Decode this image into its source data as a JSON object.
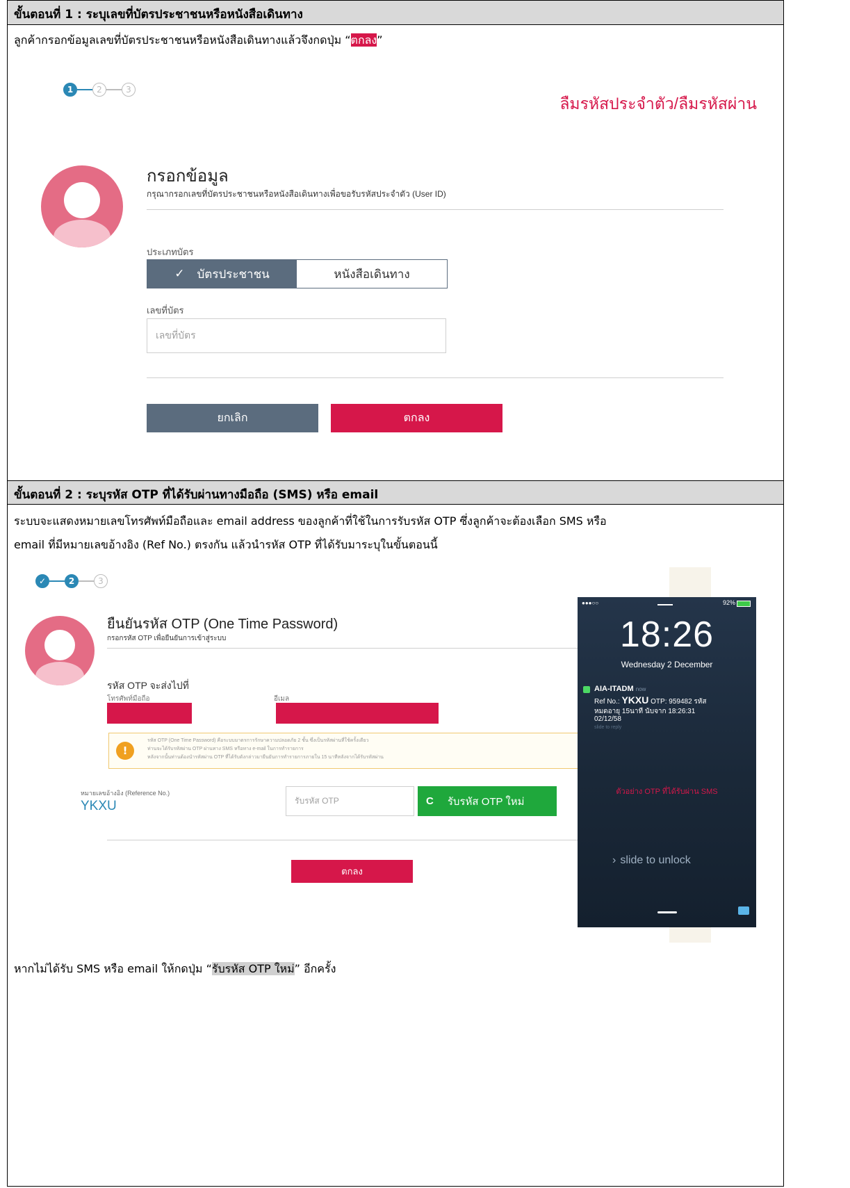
{
  "step1": {
    "header": "ขั้นตอนที่ 1 : ระบุเลขที่บัตรประชาชนหรือหนังสือเดินทาง",
    "instruction_before": "ลูกค้ากรอกข้อมูลเลขที่บัตรประชาชนหรือหนังสือเดินทางแล้วจึงกดปุ่ม “",
    "instruction_highlight": "ตกลง",
    "instruction_after": "”",
    "screenshot": {
      "steps": [
        "1",
        "2",
        "3"
      ],
      "page_heading": "ลืมรหัสประจำตัว/ลืมรหัสผ่าน",
      "form_title": "กรอกข้อมูล",
      "form_subtitle": "กรุณากรอกเลขที่บัตรประชาชนหรือหนังสือเดินทางเพื่อขอรับรหัสประจำตัว (User ID)",
      "card_type_label": "ประเภทบัตร",
      "card_type_options": [
        "บัตรประชาชน",
        "หนังสือเดินทาง"
      ],
      "card_type_selected": "บัตรประชาชน",
      "check_glyph": "✓",
      "card_number_label": "เลขที่บัตร",
      "card_number_placeholder": "เลขที่บัตร",
      "cancel_label": "ยกเลิก",
      "ok_label": "ตกลง"
    }
  },
  "step2": {
    "header": "ขั้นตอนที่ 2 : ระบุรหัส OTP ที่ได้รับผ่านทางมือถือ (SMS) หรือ email",
    "paragraph_line1": "ระบบจะแสดงหมายเลขโทรศัพท์มือถือและ email address ของลูกค้าที่ใช้ในการรับรหัส OTP ซึ่งลูกค้าจะต้องเลือก SMS หรือ",
    "paragraph_line2": "email ที่มีหมายเลขอ้างอิง (Ref No.) ตรงกัน แล้วนำรหัส OTP ที่ได้รับมาระบุในขั้นตอนนี้",
    "screenshot": {
      "steps": [
        "✓",
        "2",
        "3"
      ],
      "form_title": "ยืนยันรหัส OTP (One Time Password)",
      "form_subtitle": "กรอกรหัส OTP เพื่อยืนยันการเข้าสู่ระบบ",
      "send_to_label": "รหัส OTP จะส่งไปที่",
      "mobile_label": "โทรศัพท์มือถือ",
      "email_label": "อีเมล",
      "notice_line1": "รหัส OTP (One Time Password) คือระบบมาตรการรักษาความปลอดภัย 2 ชั้น ซึ่งเป็นรหัสผ่านที่ใช้ครั้งเดียว",
      "notice_line2": "ท่านจะได้รับรหัสผ่าน OTP ผ่านทาง SMS หรือทาง e-mail ในการทำรายการ",
      "notice_line3": "หลังจากนั้นท่านต้องนำรหัสผ่าน OTP ที่ได้รับดังกล่าวมายืนยันการทำรายการภายใน 15 นาทีหลังจากได้รับรหัสผ่าน",
      "ref_label": "หมายเลขอ้างอิง (Reference No.)",
      "ref_value": "YKXU",
      "otp_placeholder": "รับรหัส OTP",
      "resend_label": "รับรหัส OTP ใหม่",
      "resend_glyph": "C",
      "ok_label": "ตกลง"
    },
    "phone": {
      "carrier": "●●●○○",
      "battery": "92%",
      "time": "18:26",
      "date": "Wednesday 2 December",
      "sender": "AIA-ITADM",
      "sender_time": "now",
      "msg_ref_prefix": "Ref No.:",
      "msg_ref": "YKXU",
      "msg_line1": "OTP: 959482 รหัส",
      "msg_line2": "หมดอายุ 15นาที นับจาก 18:26:31",
      "msg_line3": "02/12/58",
      "slide_reply": "slide to reply",
      "caption": "ตัวอย่าง OTP ที่ได้รับผ่าน SMS",
      "slide_unlock": "slide to unlock"
    },
    "footer_before": "หากไม่ได้รับ SMS หรือ email ให้กดปุ่ม “",
    "footer_highlight": "รับรหัส OTP ใหม่",
    "footer_after": "” อีกครั้ง"
  }
}
